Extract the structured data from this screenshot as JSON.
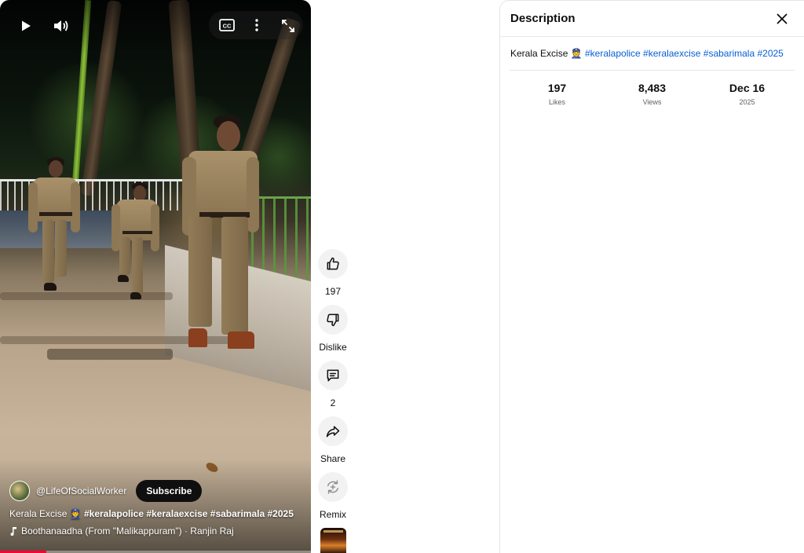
{
  "player": {
    "controls": {
      "play_icon": "play-icon",
      "volume_icon": "volume-icon",
      "captions_icon": "closed-captions-icon",
      "more_icon": "more-vert-icon",
      "fullscreen_icon": "fullscreen-icon"
    },
    "channel": {
      "handle": "@LifeOfSocialWorker",
      "subscribe_label": "Subscribe"
    },
    "title": {
      "prefix": "Kerala Excise 👮 ",
      "hashtags": "#keralapolice #keralaexcise #sabarimala #2025"
    },
    "music": {
      "icon": "music-note-icon",
      "text": "Boothanaadha (From \"Malikappuram\") · Ranjin Raj"
    },
    "progress_fraction": 0.15
  },
  "actions": {
    "like": {
      "icon": "thumb-up-icon",
      "label": "197"
    },
    "dislike": {
      "icon": "thumb-down-icon",
      "label": "Dislike"
    },
    "comments": {
      "icon": "comment-icon",
      "label": "2"
    },
    "share": {
      "icon": "share-icon",
      "label": "Share"
    },
    "remix": {
      "icon": "remix-icon",
      "label": "Remix"
    }
  },
  "description": {
    "title": "Description",
    "close_icon": "close-icon",
    "text": "Kerala Excise 👮 ",
    "hashtags": [
      "#keralapolice",
      "#keralaexcise",
      "#sabarimala",
      "#2025"
    ],
    "stats": [
      {
        "value": "197",
        "label": "Likes"
      },
      {
        "value": "8,483",
        "label": "Views"
      },
      {
        "value": "Dec 16",
        "label": "2025"
      }
    ]
  },
  "colors": {
    "link": "#065fd4",
    "progress": "#ff0033",
    "subscribe_bg": "#0f0f0f"
  }
}
